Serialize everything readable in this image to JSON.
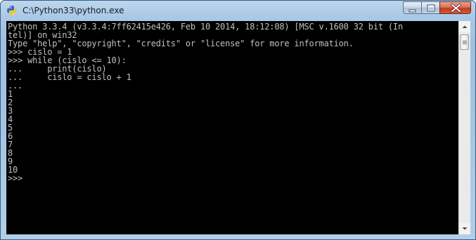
{
  "window": {
    "title": "C:\\Python33\\python.exe",
    "icon": "python-icon",
    "controls": [
      "minimize-icon",
      "maximize-icon",
      "close-icon"
    ]
  },
  "console": {
    "lines": [
      "Python 3.3.4 (v3.3.4:7ff62415e426, Feb 10 2014, 18:12:08) [MSC v.1600 32 bit (In",
      "tel)] on win32",
      "Type \"help\", \"copyright\", \"credits\" or \"license\" for more information.",
      ">>> cislo = 1",
      ">>> while (cislo <= 10):",
      "...     print(cislo)",
      "...     cislo = cislo + 1",
      "...",
      "1",
      "2",
      "3",
      "4",
      "5",
      "6",
      "7",
      "8",
      "9",
      "10",
      ">>>"
    ],
    "text_color": "#c0c0c0",
    "background": "#000000"
  }
}
